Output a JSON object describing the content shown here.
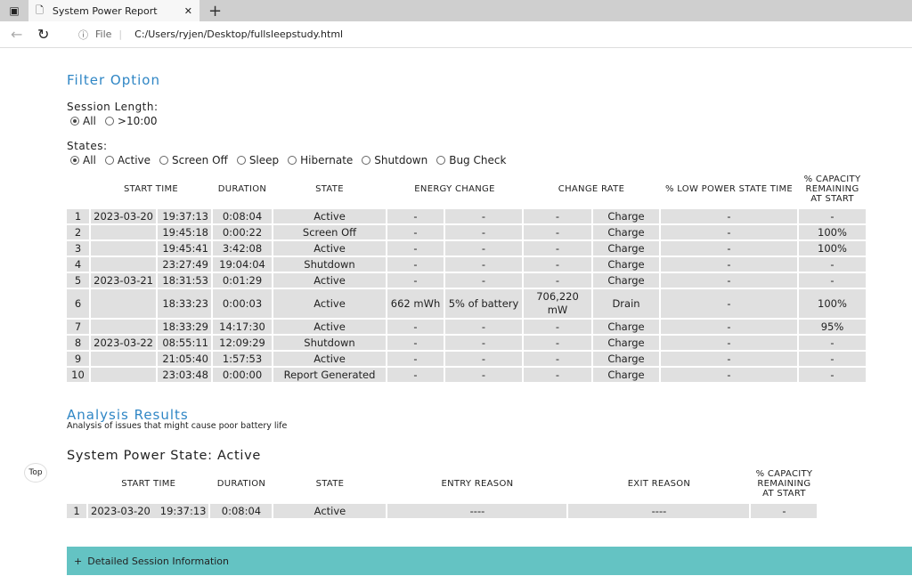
{
  "browser": {
    "tab_title": "System Power Report",
    "file_label": "File",
    "url": "C:/Users/ryjen/Desktop/fullsleepstudy.html"
  },
  "filter": {
    "title": "Filter Option",
    "session_length_label": "Session Length:",
    "session_options": [
      "All",
      ">10:00"
    ],
    "session_selected": 0,
    "states_label": "States:",
    "state_options": [
      "All",
      "Active",
      "Screen Off",
      "Sleep",
      "Hibernate",
      "Shutdown",
      "Bug Check"
    ],
    "state_selected": 0
  },
  "sessions": {
    "headers": [
      "",
      "START TIME",
      "DURATION",
      "STATE",
      "ENERGY CHANGE",
      "CHANGE RATE",
      "% LOW POWER STATE TIME",
      "% CAPACITY REMAINING AT START"
    ],
    "rows": [
      [
        "1",
        "2023-03-20",
        "19:37:13",
        "0:08:04",
        "Active",
        "-",
        "-",
        "-",
        "Charge",
        "-",
        "-"
      ],
      [
        "2",
        "",
        "19:45:18",
        "0:00:22",
        "Screen Off",
        "-",
        "-",
        "-",
        "Charge",
        "-",
        "100%"
      ],
      [
        "3",
        "",
        "19:45:41",
        "3:42:08",
        "Active",
        "-",
        "-",
        "-",
        "Charge",
        "-",
        "100%"
      ],
      [
        "4",
        "",
        "23:27:49",
        "19:04:04",
        "Shutdown",
        "-",
        "-",
        "-",
        "Charge",
        "-",
        "-"
      ],
      [
        "5",
        "2023-03-21",
        "18:31:53",
        "0:01:29",
        "Active",
        "-",
        "-",
        "-",
        "Charge",
        "-",
        "-"
      ],
      [
        "6",
        "",
        "18:33:23",
        "0:00:03",
        "Active",
        "662 mWh",
        "5% of battery",
        "706,220 mW",
        "Drain",
        "-",
        "100%"
      ],
      [
        "7",
        "",
        "18:33:29",
        "14:17:30",
        "Active",
        "-",
        "-",
        "-",
        "Charge",
        "-",
        "95%"
      ],
      [
        "8",
        "2023-03-22",
        "08:55:11",
        "12:09:29",
        "Shutdown",
        "-",
        "-",
        "-",
        "Charge",
        "-",
        "-"
      ],
      [
        "9",
        "",
        "21:05:40",
        "1:57:53",
        "Active",
        "-",
        "-",
        "-",
        "Charge",
        "-",
        "-"
      ],
      [
        "10",
        "",
        "23:03:48",
        "0:00:00",
        "Report Generated",
        "-",
        "-",
        "-",
        "Charge",
        "-",
        "-"
      ]
    ]
  },
  "analysis": {
    "title": "Analysis Results",
    "subtitle": "Analysis of issues that might cause poor battery life",
    "top_label": "Top",
    "section_title": "System Power State: Active",
    "headers": [
      "",
      "START TIME",
      "DURATION",
      "STATE",
      "ENTRY REASON",
      "EXIT REASON",
      "% CAPACITY REMAINING AT START"
    ],
    "rows": [
      [
        "1",
        "2023-03-20   19:37:13",
        "0:08:04",
        "Active",
        "----",
        "----",
        "-"
      ]
    ],
    "detail_label": "Detailed Session Information"
  }
}
